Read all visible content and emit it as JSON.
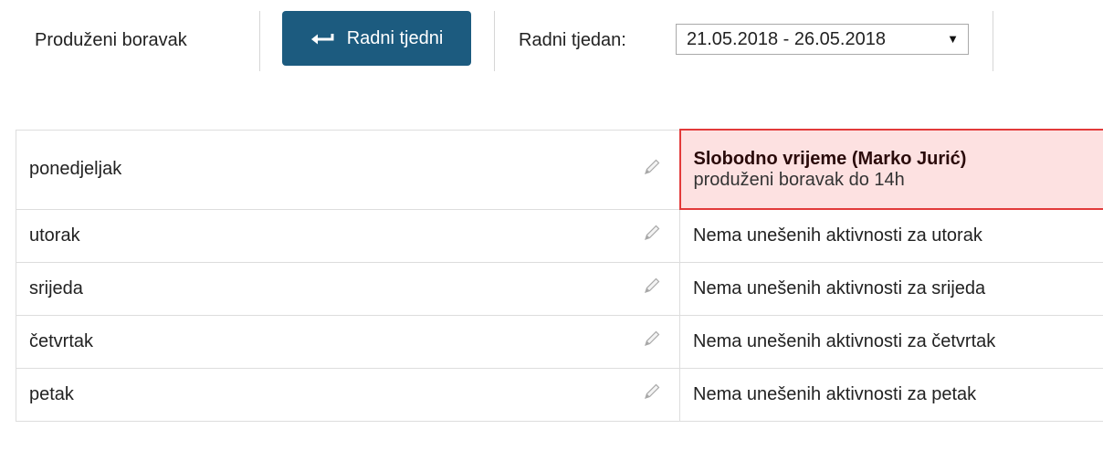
{
  "toolbar": {
    "section_label": "Produženi boravak",
    "back_button_label": "Radni tjedni",
    "week_label": "Radni tjedan:",
    "week_select_value": "21.05.2018 - 26.05.2018",
    "accent_color": "#1c5b7f"
  },
  "days": [
    {
      "name": "ponedjeljak",
      "activity_title": "Slobodno vrijeme (Marko Jurić)",
      "activity_text": "produženi boravak do 14h"
    },
    {
      "name": "utorak",
      "activity_text": "Nema unešenih aktivnosti za utorak"
    },
    {
      "name": "srijeda",
      "activity_text": "Nema unešenih aktivnosti za srijeda"
    },
    {
      "name": "četvrtak",
      "activity_text": "Nema unešenih aktivnosti za četvrtak"
    },
    {
      "name": "petak",
      "activity_text": "Nema unešenih aktivnosti za petak"
    }
  ],
  "icons": {
    "back": "return-arrow-icon",
    "edit": "pencil-icon",
    "dropdown": "dropdown-arrow-icon"
  },
  "highlight_colors": {
    "background": "#fde1e1",
    "border": "#e23a3a"
  }
}
